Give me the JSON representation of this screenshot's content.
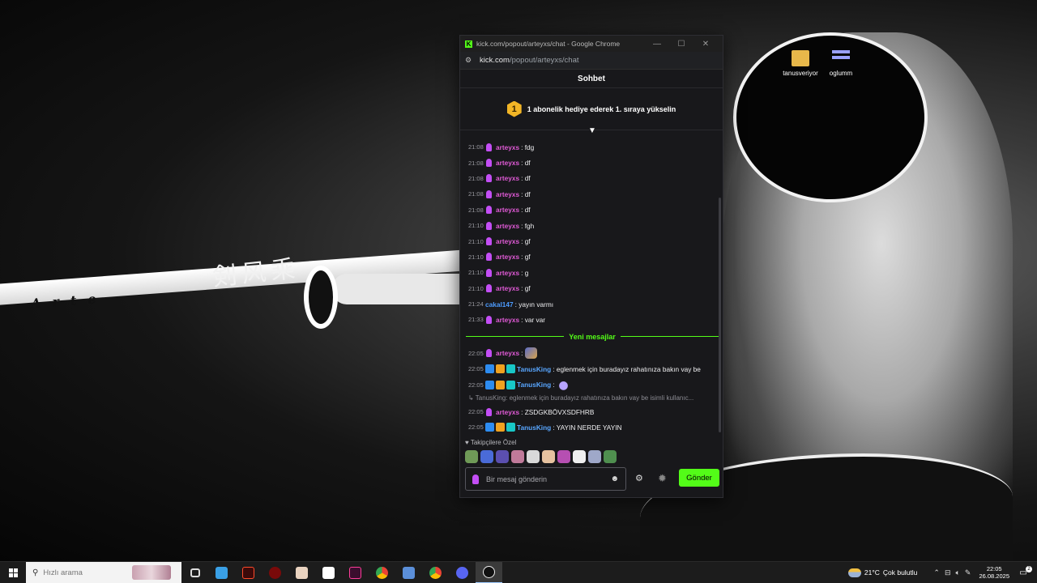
{
  "desktop": {
    "calligraphy": "剣风乘",
    "blade_text": "Arte",
    "icons": [
      {
        "label": "tanusveriyor"
      },
      {
        "label": "oglumm"
      }
    ]
  },
  "window": {
    "title": "kick.com/popout/arteyxs/chat - Google Chrome",
    "url_host": "kick.com",
    "url_path": "/popout/arteyxs/chat",
    "minimize": "—",
    "maximize": "☐",
    "close": "✕"
  },
  "chat": {
    "header": "Sohbet",
    "promo_rank": "1",
    "promo_text": "1 abonelik hediye ederek 1. sıraya yükselin",
    "messages": [
      {
        "time": "21:08",
        "user": "arteyxs",
        "text": ": fdg"
      },
      {
        "time": "21:08",
        "user": "arteyxs",
        "text": ": df"
      },
      {
        "time": "21:08",
        "user": "arteyxs",
        "text": ": df"
      },
      {
        "time": "21:08",
        "user": "arteyxs",
        "text": ": df"
      },
      {
        "time": "21:08",
        "user": "arteyxs",
        "text": ": df"
      },
      {
        "time": "21:10",
        "user": "arteyxs",
        "text": ": fgh"
      },
      {
        "time": "21:10",
        "user": "arteyxs",
        "text": ": gf"
      },
      {
        "time": "21:10",
        "user": "arteyxs",
        "text": ": gf"
      },
      {
        "time": "21:10",
        "user": "arteyxs",
        "text": ": g"
      },
      {
        "time": "21:10",
        "user": "arteyxs",
        "text": ": gf"
      },
      {
        "time": "21:24",
        "user": "cakal147",
        "text": ": yayın varmı"
      },
      {
        "time": "21:33",
        "user": "arteyxs",
        "text": ": var var"
      }
    ],
    "new_messages_label": "Yeni mesajlar",
    "new_messages": [
      {
        "time": "22:05",
        "user": "arteyxs",
        "text": ":"
      },
      {
        "time": "22:05",
        "user": "TanusKing",
        "text": ": eglenmek için buradayız rahatınıza bakın vay be"
      },
      {
        "time": "22:05",
        "user": "TanusKing",
        "text": ":"
      },
      {
        "time": "22:05",
        "user": "arteyxs",
        "text": ": ZSDGKBÖVXSDFHRB"
      },
      {
        "time": "22:05",
        "user": "TanusKing",
        "text": ": YAYIN NERDE YAYIN"
      }
    ],
    "reply_preview": "↳ TanusKing: eglenmek için buradayız rahatınıza bakın vay be isimli kullanıc...",
    "followers_only_label": "♥ Takipçilere Özel",
    "input_placeholder": "Bir mesaj gönderin",
    "send_label": "Gönder",
    "colors": {
      "accent": "#53fc18",
      "arteyxs": "#e05ad6",
      "cakal147": "#4d9cff",
      "TanusKing": "#58a6ff"
    }
  },
  "taskbar": {
    "search_placeholder": "Hızlı arama",
    "weather_temp": "21°C",
    "weather_desc": "Çok bulutlu",
    "time": "22:05",
    "date": "26.08.2025",
    "notifications": "2"
  }
}
